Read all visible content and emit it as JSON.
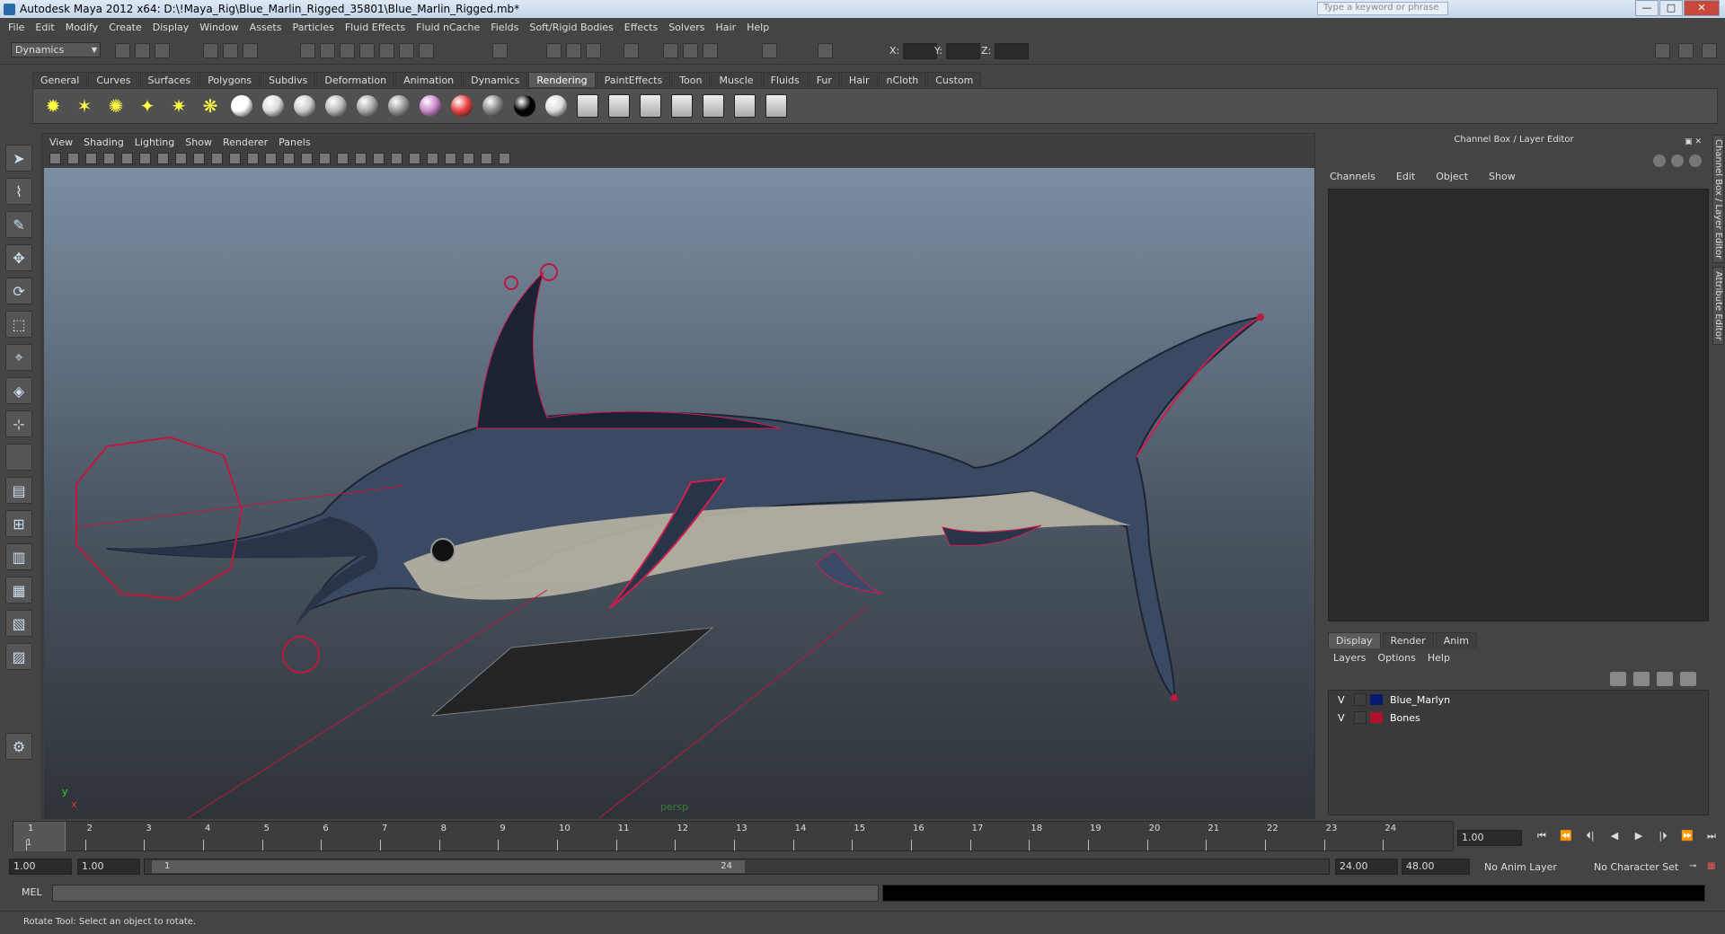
{
  "window": {
    "title": "Autodesk Maya 2012 x64: D:\\!Maya_Rig\\Blue_Marlin_Rigged_35801\\Blue_Marlin_Rigged.mb*",
    "search_placeholder": "Type a keyword or phrase",
    "min": "—",
    "max": "□",
    "close": "✕"
  },
  "menubar": [
    "File",
    "Edit",
    "Modify",
    "Create",
    "Display",
    "Window",
    "Assets",
    "Particles",
    "Fluid Effects",
    "Fluid nCache",
    "Fields",
    "Soft/Rigid Bodies",
    "Effects",
    "Solvers",
    "Hair",
    "Help"
  ],
  "statusline": {
    "mode": "Dynamics",
    "x_label": "X:",
    "y_label": "Y:",
    "z_label": "Z:"
  },
  "shelf": {
    "tabs": [
      "General",
      "Curves",
      "Surfaces",
      "Polygons",
      "Subdivs",
      "Deformation",
      "Animation",
      "Dynamics",
      "Rendering",
      "PaintEffects",
      "Toon",
      "Muscle",
      "Fluids",
      "Fur",
      "Hair",
      "nCloth",
      "Custom"
    ],
    "active_tab": "Rendering",
    "icons": [
      "ambient-light",
      "directional-light",
      "point-light",
      "spot-light",
      "area-light",
      "volume-light",
      "render-globe",
      "lambert-material",
      "blinn-material",
      "phong-material",
      "phongE-material",
      "anisotropic-material",
      "layered-shader",
      "ramp-shader",
      "surface-shader",
      "black-shader",
      "use-background-shader",
      "render-view",
      "render-current",
      "ipr-render",
      "render-settings",
      "hypershade",
      "batch-render",
      "paint-fx-brush"
    ]
  },
  "viewport": {
    "menu": [
      "View",
      "Shading",
      "Lighting",
      "Show",
      "Renderer",
      "Panels"
    ],
    "camera": "persp",
    "axis_y": "y",
    "axis_x": "x"
  },
  "channel_box": {
    "title": "Channel Box / Layer Editor",
    "menu": [
      "Channels",
      "Edit",
      "Object",
      "Show"
    ]
  },
  "side_tabs": [
    "Channel Box / Layer Editor",
    "Attribute Editor"
  ],
  "layer_editor": {
    "tabs": [
      "Display",
      "Render",
      "Anim"
    ],
    "active_tab": "Display",
    "menu": [
      "Layers",
      "Options",
      "Help"
    ],
    "layers": [
      {
        "visible": "V",
        "name": "Blue_Marlyn",
        "color": "#0a1a6e"
      },
      {
        "visible": "V",
        "name": "Bones",
        "color": "#b0102a"
      }
    ]
  },
  "timeslider": {
    "frames": [
      "1",
      "2",
      "3",
      "4",
      "5",
      "6",
      "7",
      "8",
      "9",
      "10",
      "11",
      "12",
      "13",
      "14",
      "15",
      "16",
      "17",
      "18",
      "19",
      "20",
      "21",
      "22",
      "23",
      "24"
    ],
    "current_indicator": "1",
    "current_frame": "1.00",
    "controls": [
      "⏮",
      "⏪",
      "⏴|",
      "◀",
      "▶",
      "|⏵",
      "⏩",
      "⏭"
    ]
  },
  "range_slider": {
    "start_time": "1.00",
    "playback_start": "1.00",
    "handle_start": "1",
    "handle_end": "24",
    "playback_end": "24.00",
    "end_time": "48.00",
    "anim_layer": "No Anim Layer",
    "character_set": "No Character Set"
  },
  "command_line": {
    "label": "MEL"
  },
  "help_line": "Rotate Tool: Select an object to rotate."
}
